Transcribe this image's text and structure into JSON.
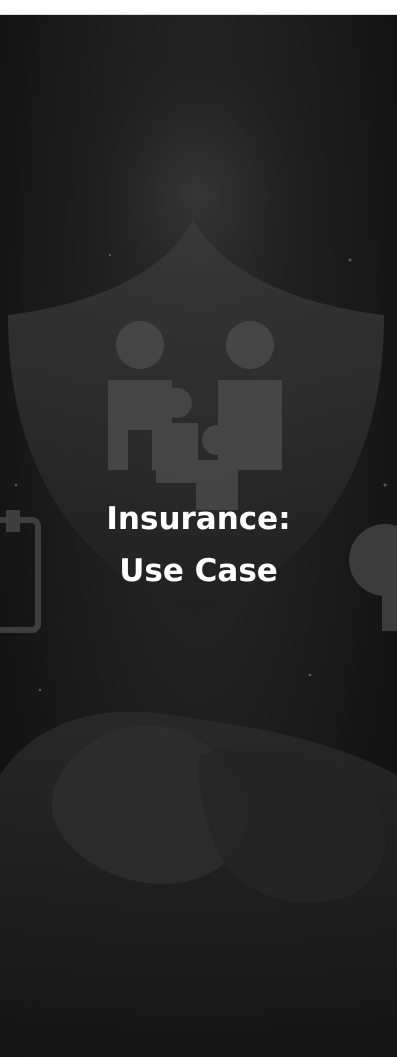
{
  "hero": {
    "title_line_1": "Insurance:",
    "title_line_2": "Use Case",
    "background_color": "#141414",
    "text_color": "#ffffff",
    "icons": [
      "shield-icon",
      "family-icon",
      "hands-icon",
      "document-icon",
      "lightbulb-icon"
    ]
  }
}
